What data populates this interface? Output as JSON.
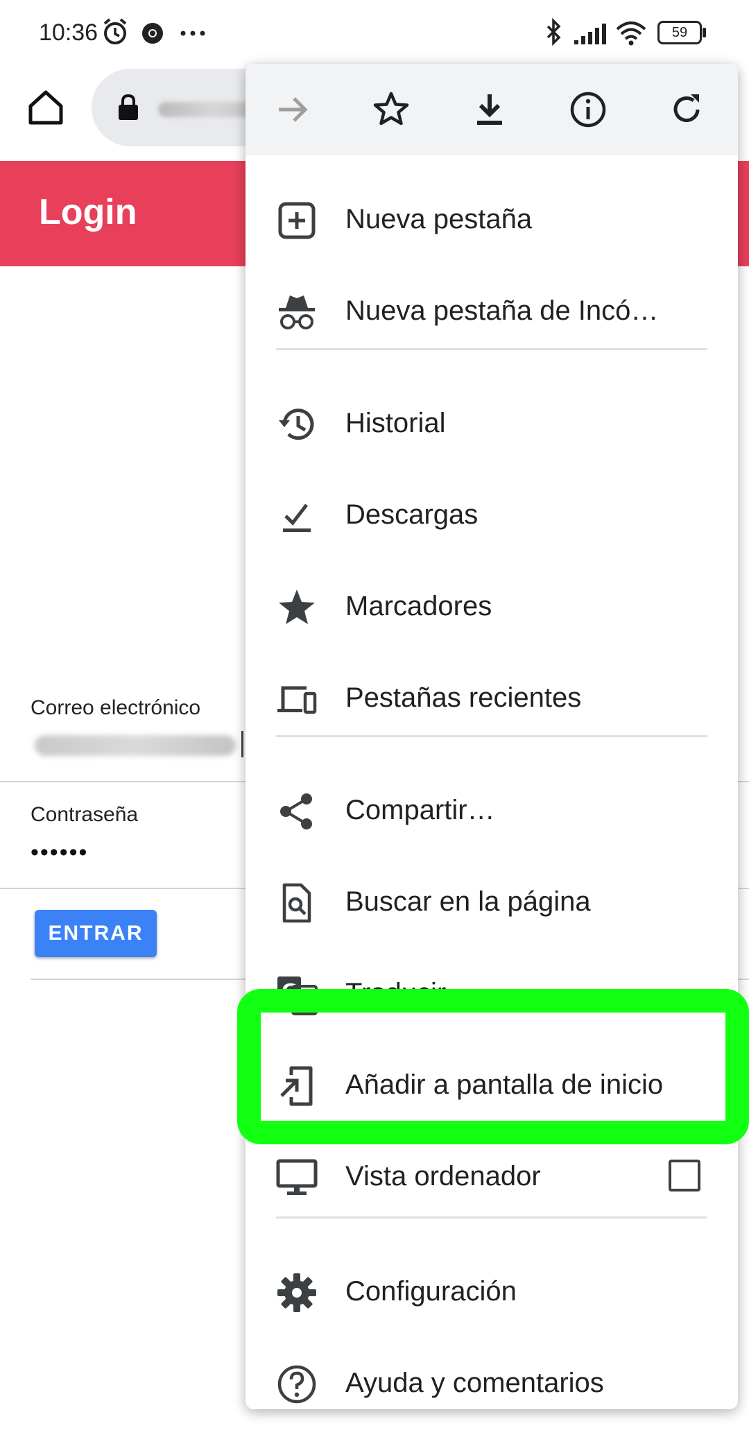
{
  "status_bar": {
    "time": "10:36",
    "battery": "59",
    "icons": [
      "alarm-icon",
      "chrome-icon",
      "more-dots-icon",
      "bluetooth-icon",
      "signal-icon",
      "wifi-icon",
      "battery-icon"
    ]
  },
  "toolbar": {
    "home_icon": "home-icon",
    "lock_icon": "lock-icon"
  },
  "page": {
    "title": "Login",
    "email_label": "Correo electrónico",
    "password_label": "Contraseña",
    "password_value": "••••••",
    "enter_label": "ENTRAR"
  },
  "menu": {
    "top_icons": [
      "forward-arrow-icon",
      "star-outline-icon",
      "download-icon",
      "info-icon",
      "refresh-icon"
    ],
    "items": [
      {
        "label": "Nueva pestaña",
        "icon": "new-tab-icon"
      },
      {
        "label": "Nueva pestaña de Incó…",
        "icon": "incognito-icon"
      },
      {
        "label": "Historial",
        "icon": "history-icon"
      },
      {
        "label": "Descargas",
        "icon": "downloads-check-icon"
      },
      {
        "label": "Marcadores",
        "icon": "bookmark-star-icon"
      },
      {
        "label": "Pestañas recientes",
        "icon": "devices-icon"
      },
      {
        "label": "Compartir…",
        "icon": "share-icon"
      },
      {
        "label": "Buscar en la página",
        "icon": "find-in-page-icon"
      },
      {
        "label": "Traducir…",
        "icon": "translate-icon"
      },
      {
        "label": "Añadir a pantalla de inicio",
        "icon": "add-to-home-icon"
      },
      {
        "label": "Vista ordenador",
        "icon": "desktop-icon",
        "checked": false
      },
      {
        "label": "Configuración",
        "icon": "gear-icon"
      },
      {
        "label": "Ayuda y comentarios",
        "icon": "help-icon"
      }
    ]
  },
  "colors": {
    "header": "#e8405a",
    "button": "#3b82f6",
    "highlight": "#11ff11"
  }
}
